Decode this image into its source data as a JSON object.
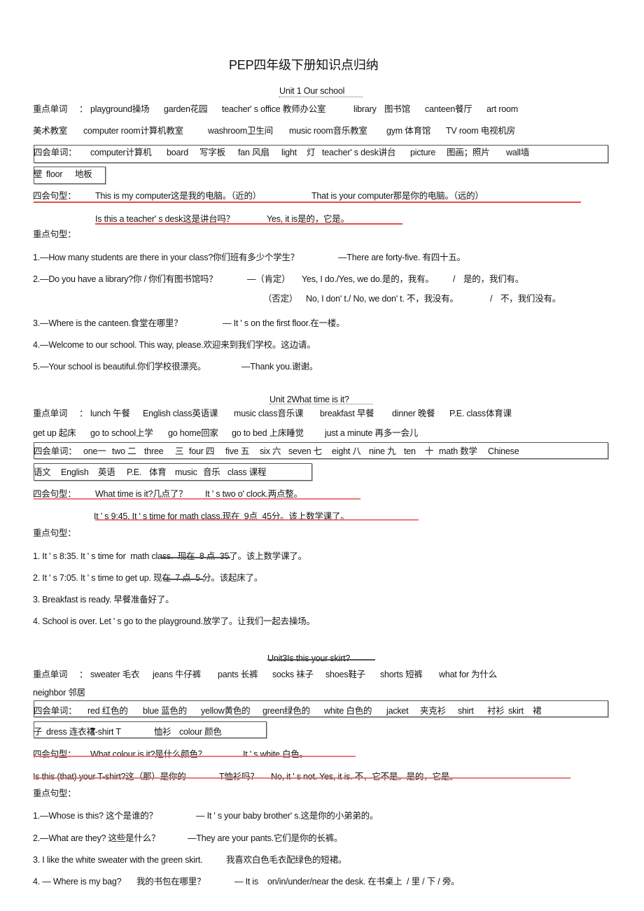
{
  "document": {
    "title": "PEP四年级下册知识点归纳"
  },
  "labels": {
    "key_words": "重点单词",
    "colon": "：",
    "four_skill_words": "四会单词：",
    "four_skill_sentences": "四会句型：",
    "key_sentences": "重点句型："
  },
  "unit1": {
    "title": "Unit 1 Our school",
    "key_words": [
      "playground操场",
      "garden花园",
      "teacher' s office 教师办公室",
      "library",
      "图书馆",
      "canteen餐厅",
      "art room"
    ],
    "key_words_row2": [
      "美术教室",
      "computer room计算机教室",
      "washroom卫生间",
      "music room音乐教室",
      "gym 体育馆",
      "TV room 电视机房"
    ],
    "four_skill_words": [
      "computer计算机",
      "board",
      "写字板",
      "fan 风扇",
      "light",
      "灯",
      "teacher' s desk讲台",
      "picture",
      "图画；照片",
      "wall墙"
    ],
    "four_skill_words_row2": [
      "壁",
      "floor",
      "地板"
    ],
    "four_skill_sentences": [
      [
        "This is my computer这是我的电脑。（近的）",
        "That is your computer那是你的电脑。（远的）"
      ],
      [
        "Is this a teacher' s desk这是讲台吗？",
        "Yes, it is是的，它是。"
      ]
    ],
    "key_sentences": [
      [
        "1.—How many students are there in your class?你们班有多少个学生？",
        "—There are forty-five. 有四十五。"
      ],
      [
        "2.—Do you have a library?你 / 你们有图书馆吗？",
        "—（肯定）",
        "Yes, I do./Yes, we do.是的，我有。",
        "/",
        "是的，我们有。"
      ],
      [
        "（否定）",
        "No, I don' t./ No, we don' t. 不，我没有。",
        "/",
        "不，我们没有。"
      ],
      [
        "3.—Where is the canteen.食堂在哪里？",
        "— It ' s on the first floor.在一楼。"
      ],
      [
        "4.—Welcome to our school. This way, please.欢迎来到我们学校。这边请。"
      ],
      [
        "5.—Your school is beautiful.你们学校很漂亮。",
        "—Thank you.谢谢。"
      ]
    ]
  },
  "unit2": {
    "title": "Unit 2What time is it?",
    "key_words": [
      "lunch 午餐",
      "English class英语课",
      "music class音乐课",
      "breakfast 早餐",
      "dinner 晚餐",
      "P.E. class体育课"
    ],
    "key_words_row2": [
      "get up 起床",
      "go to school上学",
      "go home回家",
      "go to bed 上床睡觉",
      "just a minute 再多一会儿"
    ],
    "four_skill_words": [
      "one一",
      "two 二",
      "three",
      "三",
      "four 四",
      "five 五",
      "six 六",
      "seven 七",
      "eight 八",
      "nine 九",
      "ten",
      "十",
      "math 数学",
      "Chinese"
    ],
    "four_skill_words_row2": [
      "语文",
      "English",
      "英语",
      "P.E.",
      "体育",
      "music",
      "音乐",
      "class 课程"
    ],
    "four_skill_sentences": [
      [
        "What time is it?几点了？",
        "It ' s two o' clock.两点整。"
      ],
      [
        "It ' s 9:45. It ' s time for math class.现在  9点  45分。该上数学课了。"
      ]
    ],
    "key_sentences": [
      "1. It ' s 8:35. It ' s time for  math class.  现在  8 点  35了。该上数学课了。",
      "2. It ' s 7:05. It ' s time to get up. 现在  7 点  5 分。该起床了。",
      "3. Breakfast is ready. 早餐准备好了。",
      "4. School is over. Let ' s go to the playground.放学了。让我们一起去操场。"
    ]
  },
  "unit3": {
    "title": "Unit3Is this your skirt?",
    "key_words": [
      "sweater 毛衣",
      "jeans 牛仔裤",
      "pants 长裤",
      "socks 袜子",
      "shoes鞋子",
      "shorts 短裤",
      "what for 为什么"
    ],
    "key_words_row2": [
      "neighbor 邻居"
    ],
    "four_skill_words": [
      "red 红色的",
      "blue 蓝色的",
      "yellow黄色的",
      "green绿色的",
      "white 白色的",
      "jacket",
      "夹克衫",
      "shirt",
      "衬衫",
      "skirt",
      "裙"
    ],
    "four_skill_words_row2": [
      "子",
      "dress 连衣裙",
      "T-shirt T",
      "恤衫",
      "colour 颜色"
    ],
    "four_skill_sentences": [
      [
        "What colour is it?是什么颜色？",
        "It ' s white.白色。"
      ],
      [
        "Is this (that) your T-shirt?这（那）是你的",
        "T恤衫吗？",
        "No, it ' s not. Yes, it is. 不，它不是。是的，它是。"
      ]
    ],
    "key_sentences": [
      [
        "1.—Whose is this? 这个是谁的？",
        "— It ' s your baby brother' s.这是你的小弟弟的。"
      ],
      [
        "2.—What are they? 这些是什么？",
        "—They are your pants.它们是你的长裤。"
      ],
      [
        "3. I like the white sweater with the green skirt.",
        "我喜欢白色毛衣配绿色的短裙。"
      ],
      [
        "4. — Where is my bag?",
        "我的书包在哪里？",
        "— It is",
        "on/in/under/near the desk. 在书桌上  / 里 / 下 / 旁。"
      ]
    ]
  },
  "colors": {
    "annotation_underline": "#e53a32",
    "box_border": "#555555"
  }
}
